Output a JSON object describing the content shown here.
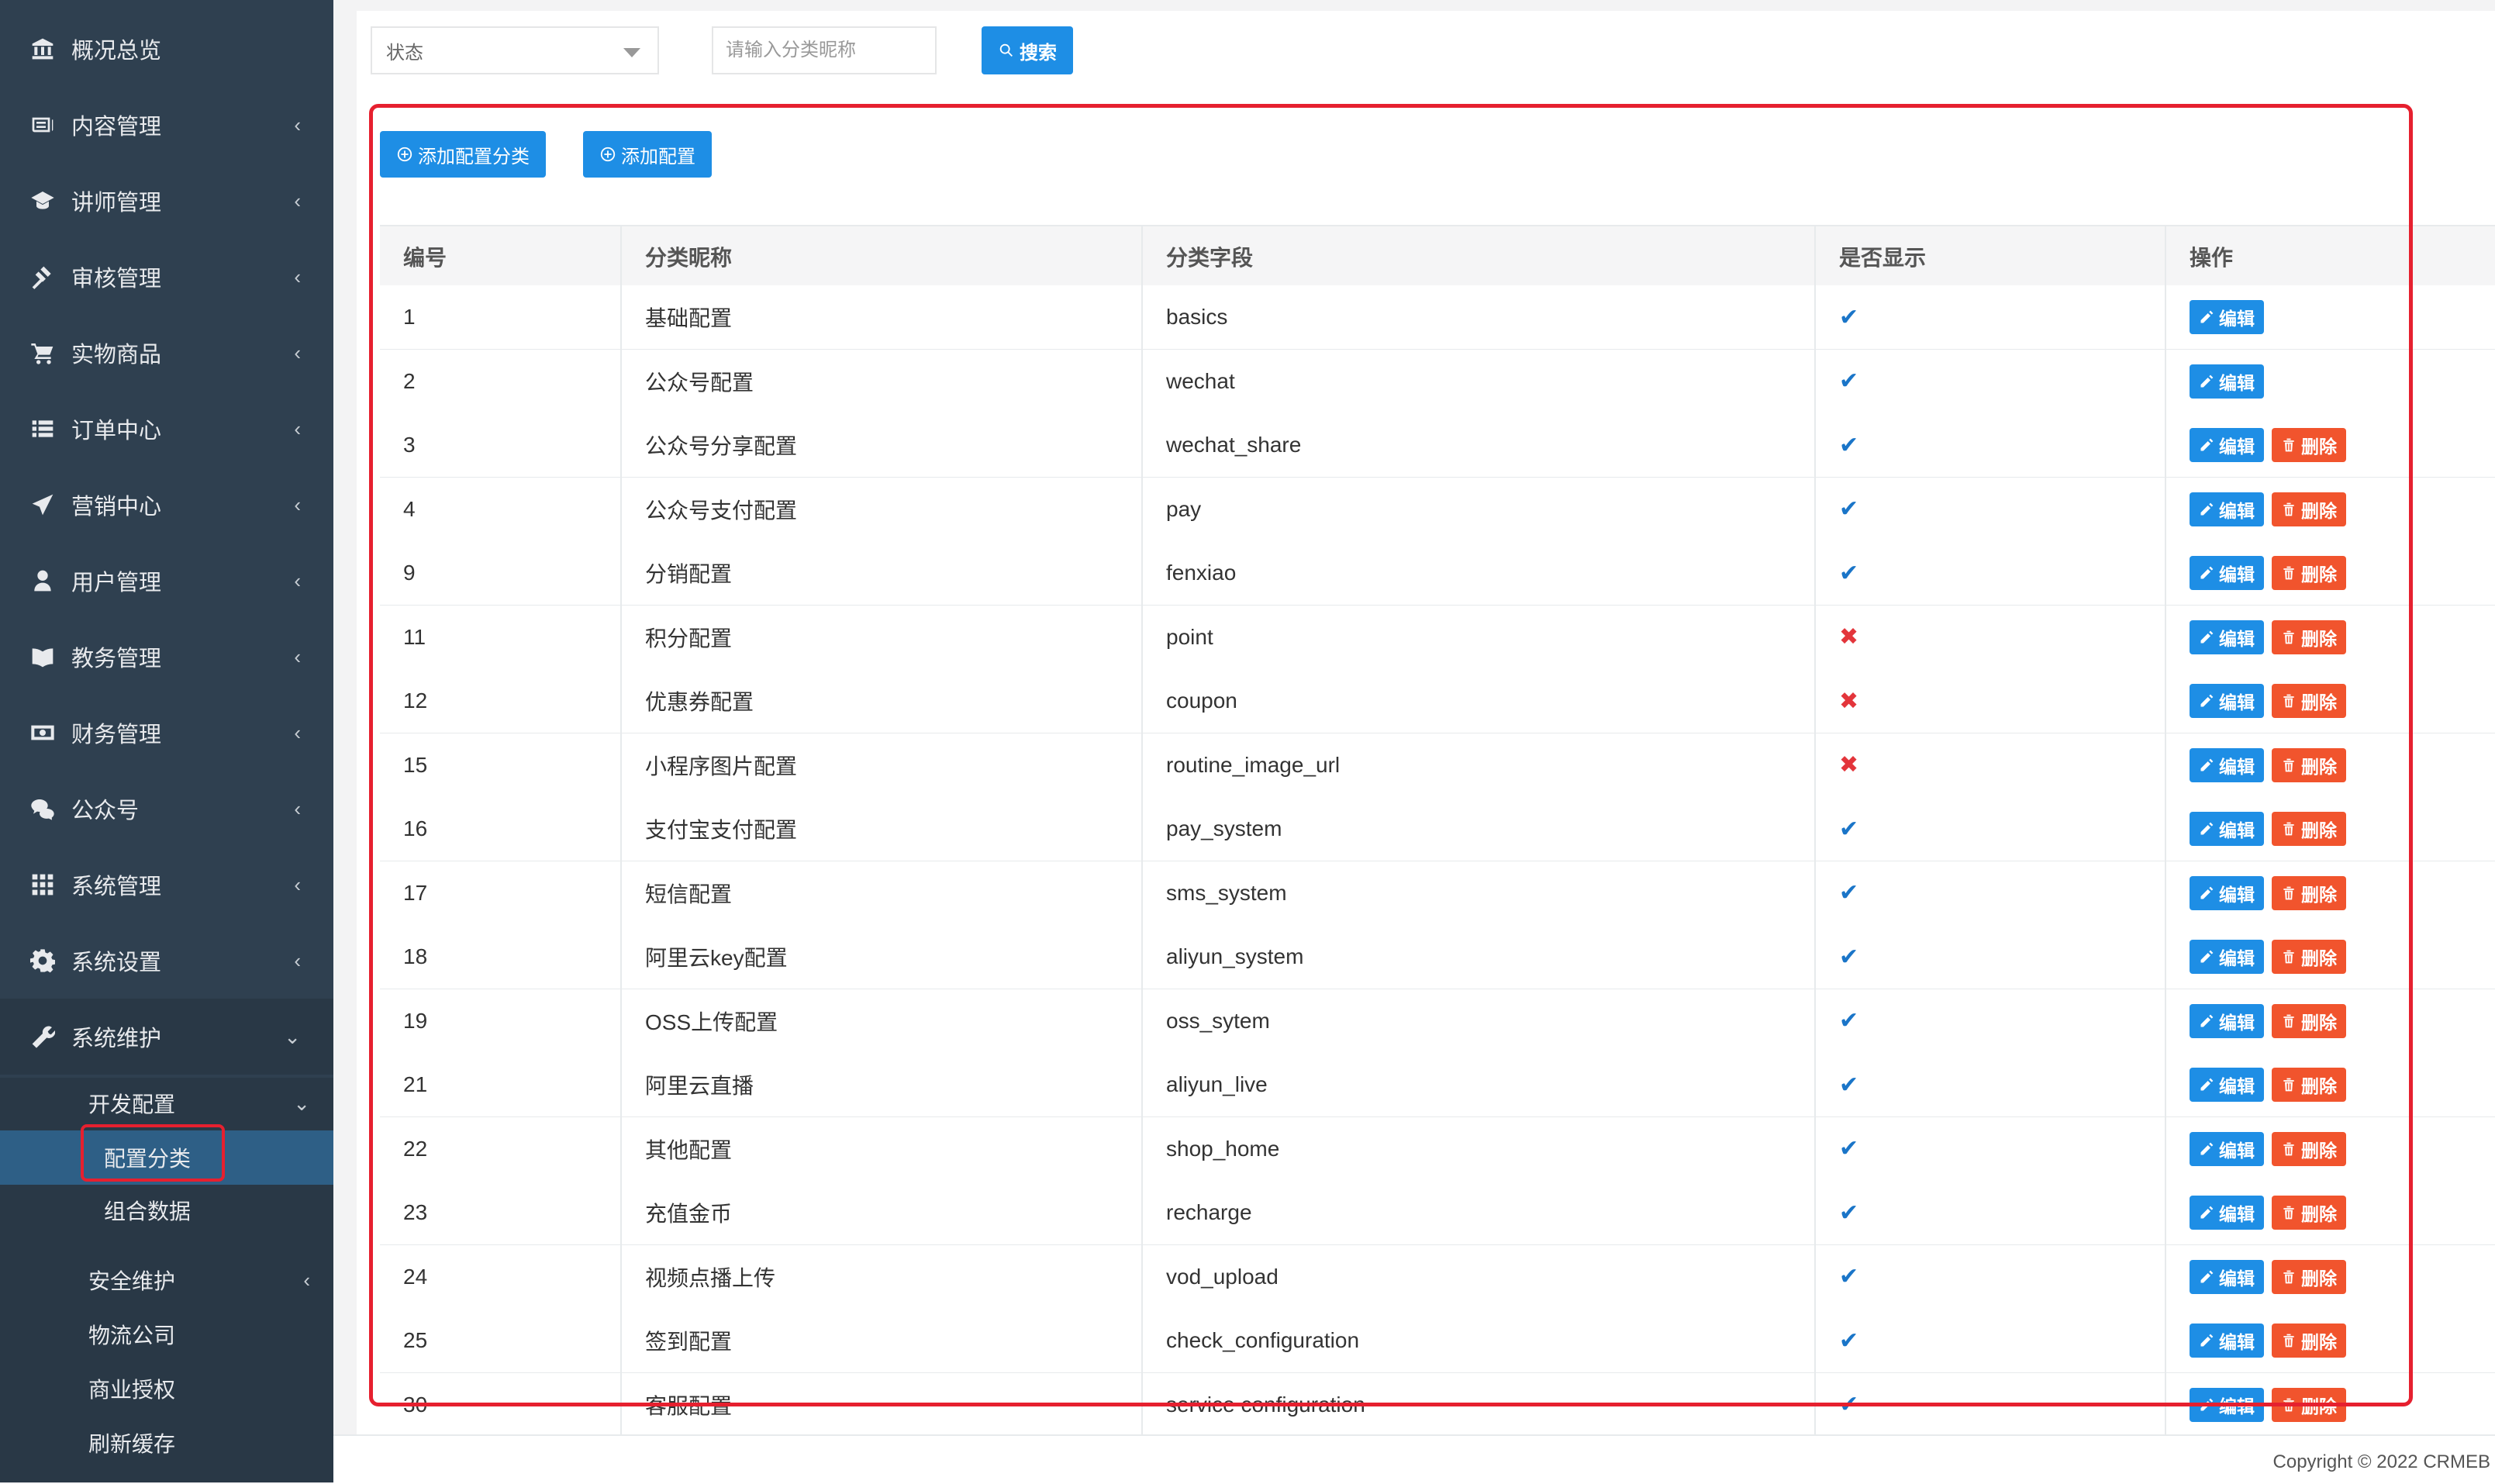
{
  "sidebar": {
    "items": [
      {
        "label": "概况总览",
        "icon": "bank-icon",
        "chevron": ""
      },
      {
        "label": "内容管理",
        "icon": "newspaper-icon",
        "chevron": "‹"
      },
      {
        "label": "讲师管理",
        "icon": "graduation-cap-icon",
        "chevron": "‹"
      },
      {
        "label": "审核管理",
        "icon": "gavel-icon",
        "chevron": "‹"
      },
      {
        "label": "实物商品",
        "icon": "cart-icon",
        "chevron": "‹"
      },
      {
        "label": "订单中心",
        "icon": "list-icon",
        "chevron": "‹"
      },
      {
        "label": "营销中心",
        "icon": "send-icon",
        "chevron": "‹"
      },
      {
        "label": "用户管理",
        "icon": "user-icon",
        "chevron": "‹"
      },
      {
        "label": "教务管理",
        "icon": "book-icon",
        "chevron": "‹"
      },
      {
        "label": "财务管理",
        "icon": "money-icon",
        "chevron": "‹"
      },
      {
        "label": "公众号",
        "icon": "wechat-icon",
        "chevron": "‹"
      },
      {
        "label": "系统管理",
        "icon": "grid-icon",
        "chevron": "‹"
      },
      {
        "label": "系统设置",
        "icon": "gear-icon",
        "chevron": "‹"
      },
      {
        "label": "系统维护",
        "icon": "wrench-icon",
        "chevron": "⌄"
      }
    ],
    "submenu": [
      {
        "label": "开发配置",
        "chevron": "⌄"
      },
      {
        "label": "配置分类",
        "chevron": ""
      },
      {
        "label": "组合数据",
        "chevron": ""
      },
      {
        "label": "安全维护",
        "chevron": "‹"
      },
      {
        "label": "物流公司",
        "chevron": ""
      },
      {
        "label": "商业授权",
        "chevron": ""
      },
      {
        "label": "刷新缓存",
        "chevron": ""
      }
    ]
  },
  "toolbar": {
    "status_select": "状态",
    "search_placeholder": "请输入分类昵称",
    "search_label": "搜索",
    "add_category_label": "添加配置分类",
    "add_config_label": "添加配置"
  },
  "table": {
    "headers": [
      "编号",
      "分类昵称",
      "分类字段",
      "是否显示",
      "操作"
    ],
    "edit_label": "编辑",
    "delete_label": "删除",
    "rows": [
      {
        "id": "1",
        "name": "基础配置",
        "field": "basics",
        "show": true,
        "deletable": false
      },
      {
        "id": "2",
        "name": "公众号配置",
        "field": "wechat",
        "show": true,
        "deletable": false
      },
      {
        "id": "3",
        "name": "公众号分享配置",
        "field": "wechat_share",
        "show": true,
        "deletable": true
      },
      {
        "id": "4",
        "name": "公众号支付配置",
        "field": "pay",
        "show": true,
        "deletable": true
      },
      {
        "id": "9",
        "name": "分销配置",
        "field": "fenxiao",
        "show": true,
        "deletable": true
      },
      {
        "id": "11",
        "name": "积分配置",
        "field": "point",
        "show": false,
        "deletable": true
      },
      {
        "id": "12",
        "name": "优惠券配置",
        "field": "coupon",
        "show": false,
        "deletable": true
      },
      {
        "id": "15",
        "name": "小程序图片配置",
        "field": "routine_image_url",
        "show": false,
        "deletable": true
      },
      {
        "id": "16",
        "name": "支付宝支付配置",
        "field": "pay_system",
        "show": true,
        "deletable": true
      },
      {
        "id": "17",
        "name": "短信配置",
        "field": "sms_system",
        "show": true,
        "deletable": true
      },
      {
        "id": "18",
        "name": "阿里云key配置",
        "field": "aliyun_system",
        "show": true,
        "deletable": true
      },
      {
        "id": "19",
        "name": "OSS上传配置",
        "field": "oss_sytem",
        "show": true,
        "deletable": true
      },
      {
        "id": "21",
        "name": "阿里云直播",
        "field": "aliyun_live",
        "show": true,
        "deletable": true
      },
      {
        "id": "22",
        "name": "其他配置",
        "field": "shop_home",
        "show": true,
        "deletable": true
      },
      {
        "id": "23",
        "name": "充值金币",
        "field": "recharge",
        "show": true,
        "deletable": true
      },
      {
        "id": "24",
        "name": "视频点播上传",
        "field": "vod_upload",
        "show": true,
        "deletable": true
      },
      {
        "id": "25",
        "name": "签到配置",
        "field": "check_configuration",
        "show": true,
        "deletable": true
      },
      {
        "id": "30",
        "name": "客服配置",
        "field": "service configuration",
        "show": true,
        "deletable": true
      }
    ]
  },
  "footer": {
    "copyright": "Copyright © 2022 CRMEB"
  },
  "colors": {
    "sidebar": "#2f4050",
    "primary": "#1e8ee5",
    "danger": "#f1542d",
    "highlight": "#e6202f"
  }
}
